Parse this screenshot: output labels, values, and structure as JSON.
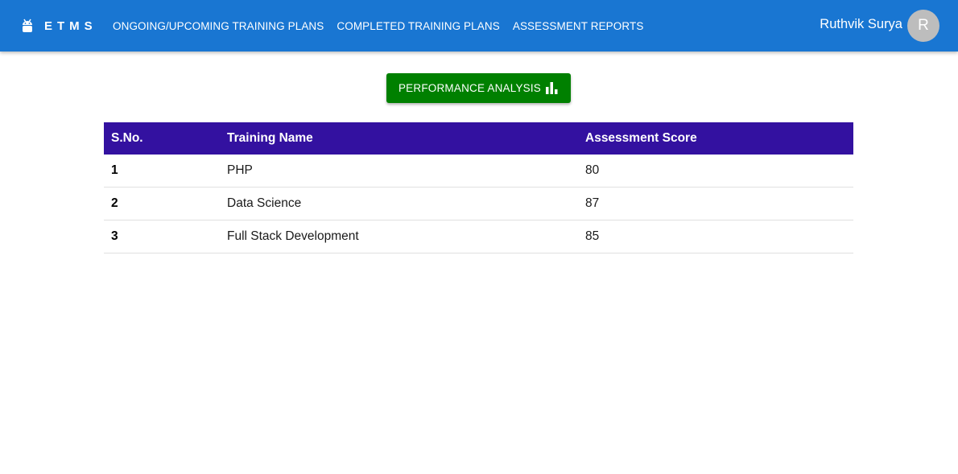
{
  "header": {
    "brand": "ETMS",
    "nav": [
      {
        "label": "ONGOING/UPCOMING TRAINING PLANS"
      },
      {
        "label": "COMPLETED TRAINING PLANS"
      },
      {
        "label": "ASSESSMENT REPORTS"
      }
    ],
    "user": {
      "name": "Ruthvik Surya",
      "avatar_initial": "R"
    },
    "bg_color": "#1976d2"
  },
  "main": {
    "performance_button": {
      "label": "PERFORMANCE ANALYSIS",
      "icon": "bar-chart-icon",
      "color": "#008000"
    },
    "table": {
      "header_color": "#3311a0",
      "columns": [
        "S.No.",
        "Training Name",
        "Assessment Score"
      ],
      "rows": [
        {
          "sno": "1",
          "name": "PHP",
          "score": "80"
        },
        {
          "sno": "2",
          "name": "Data Science",
          "score": "87"
        },
        {
          "sno": "3",
          "name": "Full Stack Development",
          "score": "85"
        }
      ]
    }
  }
}
